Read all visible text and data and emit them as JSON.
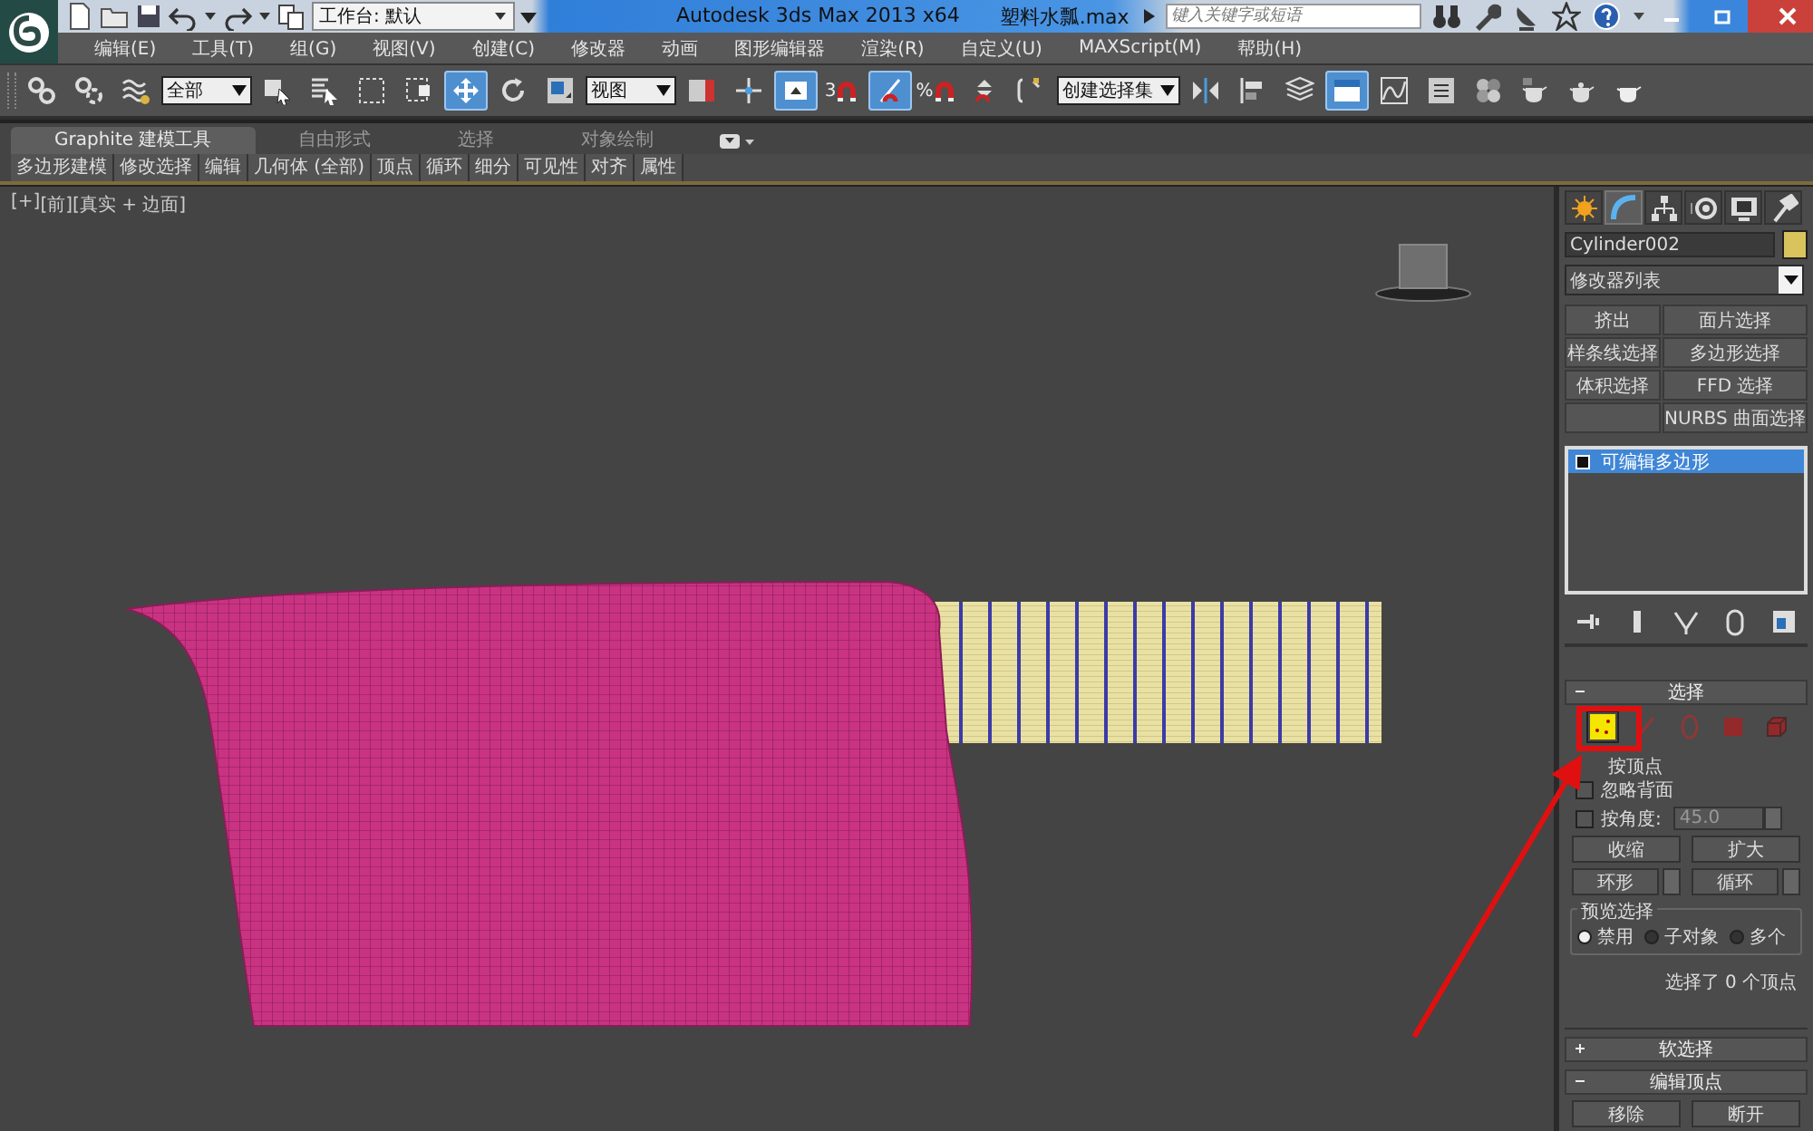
{
  "title_bar": {
    "workspace": "工作台: 默认",
    "app_title": "Autodesk 3ds Max  2013 x64",
    "file_name": "塑料水瓢.max",
    "search": {
      "placeholder": "键入关键字或短语"
    }
  },
  "menu": [
    "编辑(E)",
    "工具(T)",
    "组(G)",
    "视图(V)",
    "创建(C)",
    "修改器",
    "动画",
    "图形编辑器",
    "渲染(R)",
    "自定义(U)",
    "MAXScript(M)",
    "帮助(H)"
  ],
  "toolbar": [
    {
      "kind": "link",
      "active": false
    },
    {
      "kind": "unlink",
      "active": false
    },
    {
      "kind": "bind",
      "active": false
    },
    {
      "kind": "dropdown",
      "value": "全部"
    },
    {
      "kind": "select",
      "active": false
    },
    {
      "kind": "select-by-name",
      "active": false
    },
    {
      "kind": "region",
      "active": false
    },
    {
      "kind": "crossing",
      "active": false
    },
    {
      "kind": "move",
      "active": true
    },
    {
      "kind": "rotate",
      "active": false
    },
    {
      "kind": "scale",
      "active": false
    },
    {
      "kind": "dropdown",
      "value": "视图"
    },
    {
      "kind": "pivot",
      "active": false
    },
    {
      "kind": "manipulate",
      "active": false
    },
    {
      "kind": "shortcut",
      "active": true
    },
    {
      "kind": "snap",
      "label": "3",
      "active": false
    },
    {
      "kind": "angle-snap",
      "active": true
    },
    {
      "kind": "snap",
      "label": "%",
      "active": false
    },
    {
      "kind": "spinner-snap",
      "active": false
    },
    {
      "kind": "named-sets",
      "active": false
    },
    {
      "kind": "dropdown",
      "value": "创建选择集"
    },
    {
      "kind": "mirror",
      "active": false
    },
    {
      "kind": "align",
      "active": false
    },
    {
      "kind": "layers",
      "active": false
    },
    {
      "kind": "ribbon",
      "active": true
    },
    {
      "kind": "curve",
      "active": false
    },
    {
      "kind": "schematic",
      "active": false
    },
    {
      "kind": "material",
      "active": false
    },
    {
      "kind": "render-setup",
      "active": false
    },
    {
      "kind": "frame",
      "active": false
    },
    {
      "kind": "render",
      "active": false
    }
  ],
  "ribbon": {
    "tabs": [
      {
        "label": "Graphite 建模工具",
        "selected": true
      },
      {
        "label": "自由形式",
        "selected": false
      },
      {
        "label": "选择",
        "selected": false
      },
      {
        "label": "对象绘制",
        "selected": false
      }
    ],
    "panels": [
      "多边形建模",
      "修改选择",
      "编辑",
      "几何体 (全部)",
      "顶点",
      "循环",
      "细分",
      "可见性",
      "对齐",
      "属性"
    ]
  },
  "viewport": {
    "labels": [
      "[+]",
      "[前]",
      "[真实 + 边面]"
    ]
  },
  "command_panel": {
    "tabs": [
      {
        "kind": "create",
        "selected": false
      },
      {
        "kind": "modify",
        "selected": true
      },
      {
        "kind": "hierarchy",
        "selected": false
      },
      {
        "kind": "motion",
        "selected": false
      },
      {
        "kind": "display",
        "selected": false
      },
      {
        "kind": "utilities",
        "selected": false
      }
    ],
    "object_name": "Cylinder002",
    "modifier_list": "修改器列表",
    "modifier_buttons": [
      {
        "kind": "button",
        "label": "挤出"
      },
      {
        "kind": "button",
        "label": "面片选择"
      },
      {
        "kind": "button",
        "label": "样条线选择"
      },
      {
        "kind": "button",
        "label": "多边形选择"
      },
      {
        "kind": "button",
        "label": "体积选择"
      },
      {
        "kind": "button",
        "label": "FFD 选择"
      },
      {
        "kind": "blank"
      },
      {
        "kind": "button",
        "label": "NURBS 曲面选择"
      }
    ],
    "stack": [
      {
        "label": "可编辑多边形",
        "selected": true
      }
    ],
    "selection": {
      "title": "选择",
      "expanded": true,
      "levels": [
        {
          "kind": "vertex",
          "selected": true
        },
        {
          "kind": "edge",
          "selected": false
        },
        {
          "kind": "border",
          "selected": false
        },
        {
          "kind": "polygon",
          "selected": false
        },
        {
          "kind": "element",
          "selected": false
        }
      ],
      "by_vertex": "按顶点",
      "checks": [
        {
          "label": "忽略背面",
          "checked": false
        },
        {
          "label": "按角度:",
          "checked": false,
          "value": "45.0"
        }
      ],
      "buttons": [
        {
          "label": "收缩",
          "spinner": false
        },
        {
          "label": "扩大",
          "spinner": false
        },
        {
          "label": "环形",
          "spinner": true
        },
        {
          "label": "循环",
          "spinner": true
        }
      ],
      "preview": {
        "title": "预览选择",
        "options": [
          {
            "label": "禁用",
            "selected": true
          },
          {
            "label": "子对象",
            "selected": false
          },
          {
            "label": "多个",
            "selected": false
          }
        ]
      },
      "status": "选择了 0 个顶点"
    },
    "rollouts": [
      {
        "title": "软选择",
        "expanded": false
      },
      {
        "title": "编辑顶点",
        "expanded": true,
        "buttons": [
          "移除",
          "断开"
        ]
      }
    ]
  }
}
